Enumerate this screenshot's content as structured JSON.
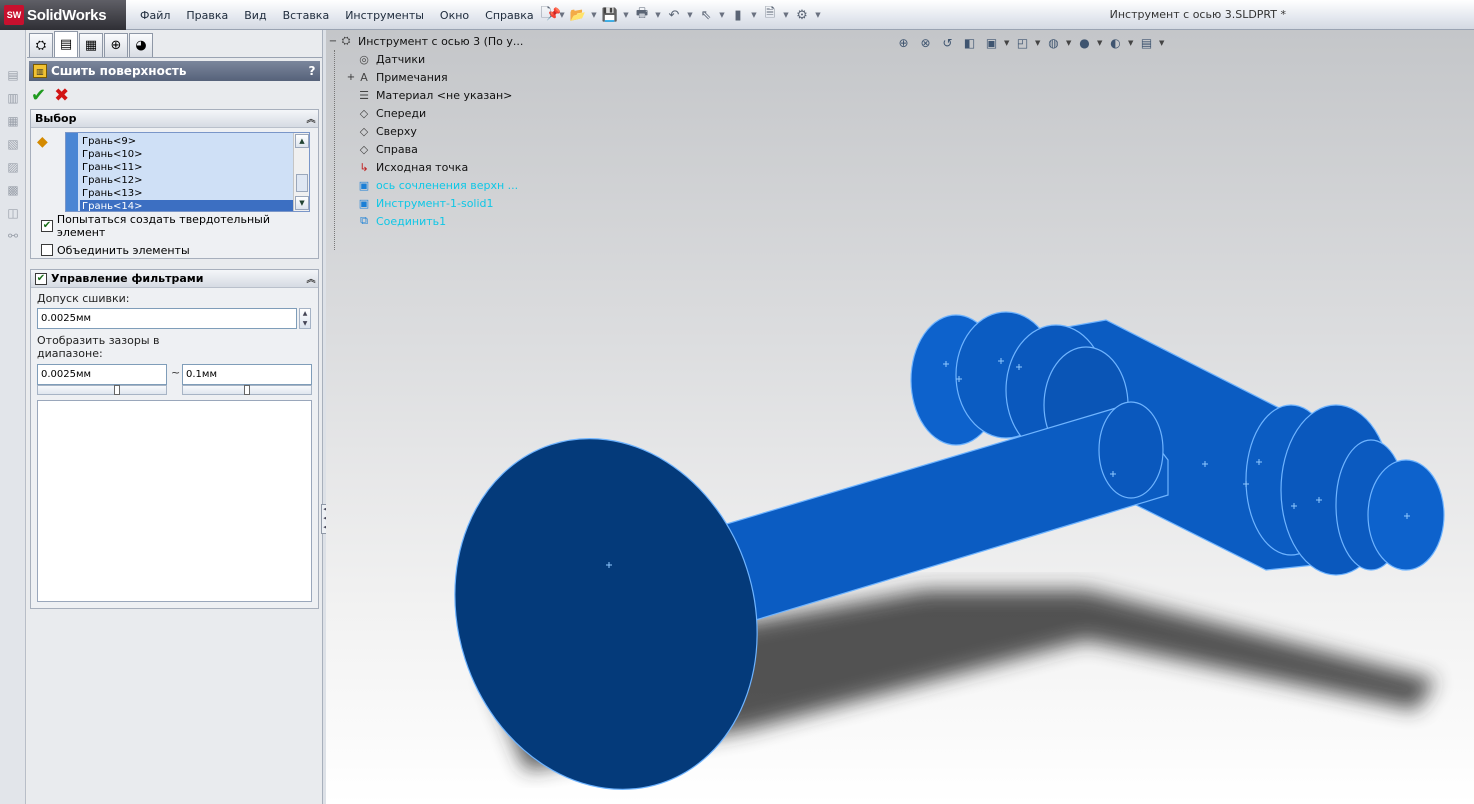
{
  "app": {
    "logo_mark": "SW",
    "logo_text": "SolidWorks",
    "document_title": "Инструмент с осью 3.SLDPRT *"
  },
  "menu": [
    {
      "label": "Файл"
    },
    {
      "label": "Правка"
    },
    {
      "label": "Вид"
    },
    {
      "label": "Вставка"
    },
    {
      "label": "Инструменты"
    },
    {
      "label": "Окно"
    },
    {
      "label": "Справка"
    }
  ],
  "quick_toolbar": [
    {
      "icon": "new-document-icon"
    },
    {
      "icon": "open-folder-icon"
    },
    {
      "icon": "save-icon"
    },
    {
      "icon": "print-icon"
    },
    {
      "icon": "undo-icon"
    },
    {
      "icon": "select-pointer-icon"
    },
    {
      "icon": "rebuild-icon"
    },
    {
      "icon": "file-properties-icon"
    },
    {
      "icon": "options-icon"
    }
  ],
  "property_manager": {
    "tabs": [
      {
        "icon": "feature-manager-icon"
      },
      {
        "icon": "property-manager-icon"
      },
      {
        "icon": "configuration-manager-icon"
      },
      {
        "icon": "dimxpert-icon"
      },
      {
        "icon": "display-manager-icon"
      }
    ],
    "title": "Сшить поверхность",
    "help": "?",
    "selection": {
      "title": "Выбор",
      "faces": [
        "Грань<9>",
        "Грань<10>",
        "Грань<11>",
        "Грань<12>",
        "Грань<13>",
        "Грань<14>"
      ],
      "selected_index": 5,
      "try_solid_label": "Попытаться создать твердотельный элемент",
      "try_solid_checked": true,
      "merge_label": "Объединить элементы",
      "merge_checked": false
    },
    "filter": {
      "title": "Управление фильтрами",
      "enabled": true,
      "tolerance_label": "Допуск сшивки:",
      "tolerance_value": "0.0025мм",
      "gaps_label_line1": "Отобразить зазоры в",
      "gaps_label_line2": "диапазоне:",
      "gap_min": "0.0025мм",
      "gap_max": "0.1мм",
      "range_separator": "~"
    }
  },
  "feature_tree": [
    {
      "label": "Инструмент с осью 3  (По у...",
      "icon": "part-icon",
      "expander": "−",
      "style": "root"
    },
    {
      "label": "Датчики",
      "icon": "sensor-icon",
      "expander": "",
      "style": "normal"
    },
    {
      "label": "Примечания",
      "icon": "annotations-icon",
      "expander": "+",
      "style": "normal"
    },
    {
      "label": "Материал <не указан>",
      "icon": "material-icon",
      "expander": "",
      "style": "normal"
    },
    {
      "label": "Спереди",
      "icon": "plane-icon",
      "expander": "",
      "style": "normal"
    },
    {
      "label": "Сверху",
      "icon": "plane-icon",
      "expander": "",
      "style": "normal"
    },
    {
      "label": "Справа",
      "icon": "plane-icon",
      "expander": "",
      "style": "normal"
    },
    {
      "label": "Исходная точка",
      "icon": "origin-icon",
      "expander": "",
      "style": "normal"
    },
    {
      "label": "ось  сочленения верхн ...",
      "icon": "surface-body-icon",
      "expander": "",
      "style": "cyan"
    },
    {
      "label": "Инструмент-1-solid1",
      "icon": "surface-body-icon",
      "expander": "",
      "style": "cyan"
    },
    {
      "label": "Соединить1",
      "icon": "combine-icon",
      "expander": "",
      "style": "cyan"
    }
  ],
  "view_toolbar": [
    {
      "icon": "zoom-to-fit-icon"
    },
    {
      "icon": "zoom-to-area-icon"
    },
    {
      "icon": "previous-view-icon"
    },
    {
      "icon": "section-view-icon"
    },
    {
      "icon": "view-orientation-icon"
    },
    {
      "icon": "display-style-icon"
    },
    {
      "icon": "hide-show-items-icon"
    },
    {
      "icon": "edit-appearance-icon"
    },
    {
      "icon": "apply-scene-icon"
    },
    {
      "icon": "view-settings-icon"
    }
  ],
  "colors": {
    "model_face": "#0b5cc2",
    "model_dark_face": "#04336b",
    "model_edge": "#6fb4ff",
    "tree_cyan": "#0ec7e6",
    "pm_header": "#5f6b82"
  }
}
